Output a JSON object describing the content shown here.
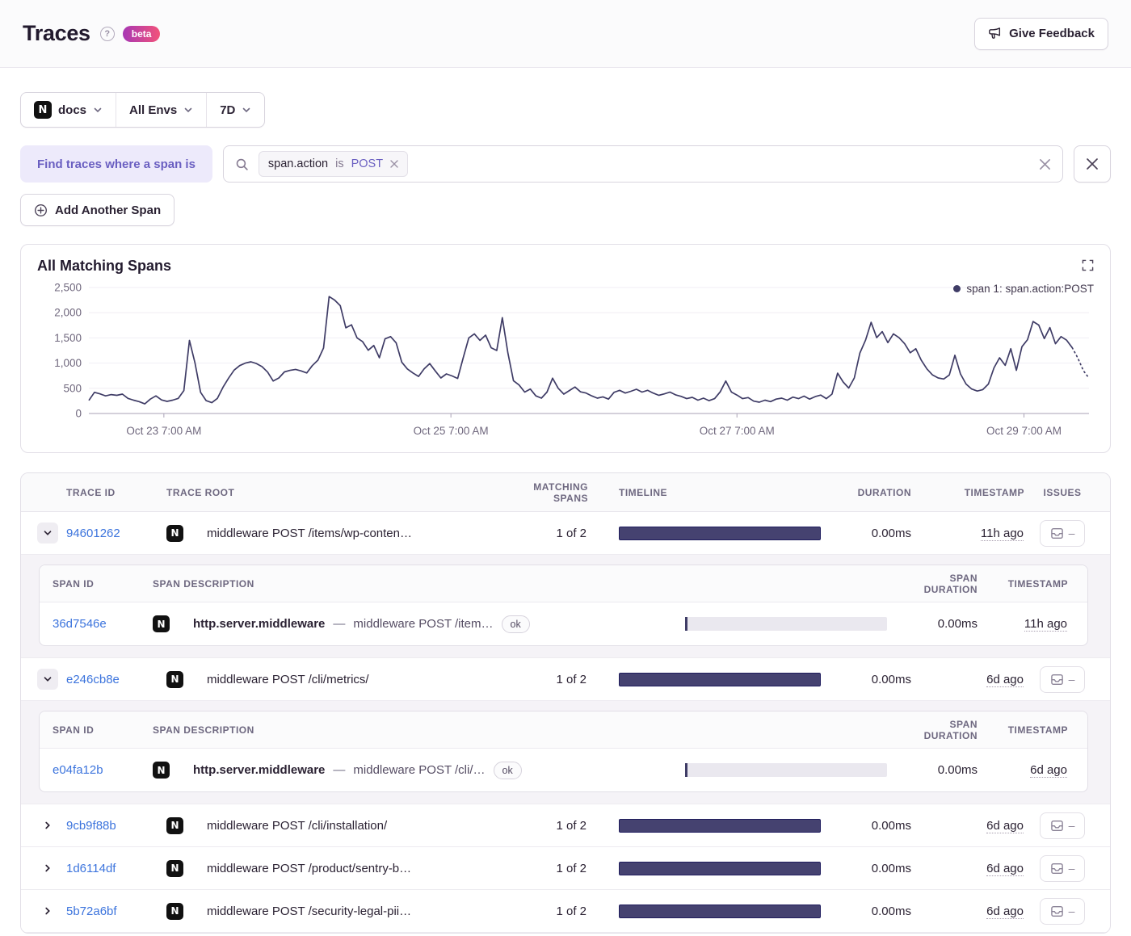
{
  "header": {
    "title": "Traces",
    "beta_label": "beta",
    "feedback_label": "Give Feedback"
  },
  "filters": {
    "project": "docs",
    "project_icon_letter": "N",
    "environment": "All Envs",
    "period": "7D"
  },
  "span_filter": {
    "label": "Find traces where a span is",
    "token": {
      "key": "span.action",
      "op": "is",
      "value": "POST"
    },
    "add_button_label": "Add Another Span",
    "search_value": "",
    "search_placeholder": ""
  },
  "chart": {
    "title": "All Matching Spans",
    "legend_label": "span 1: span.action:POST"
  },
  "chart_data": {
    "type": "line",
    "title": "All Matching Spans",
    "ylim": [
      0,
      2500
    ],
    "y_ticks": [
      0,
      500,
      1000,
      1500,
      2000,
      2500
    ],
    "y_tick_labels": [
      "0",
      "500",
      "1,000",
      "1,500",
      "2,000",
      "2,500"
    ],
    "x_tick_labels": [
      "Oct 23 7:00 AM",
      "Oct 25 7:00 AM",
      "Oct 27 7:00 AM",
      "Oct 29 7:00 AM"
    ],
    "x_tick_fractions": [
      0.075,
      0.362,
      0.648,
      0.935
    ],
    "grid": true,
    "legend_position": "top-right",
    "dashed_tail_count": 4,
    "series": [
      {
        "name": "span 1: span.action:POST",
        "color": "#3f3c66",
        "values": [
          260,
          420,
          390,
          350,
          375,
          360,
          385,
          300,
          265,
          235,
          190,
          285,
          350,
          270,
          240,
          265,
          300,
          455,
          1450,
          1000,
          420,
          255,
          215,
          300,
          520,
          700,
          860,
          950,
          1000,
          1025,
          990,
          930,
          820,
          645,
          705,
          825,
          855,
          875,
          845,
          805,
          950,
          1060,
          1300,
          2320,
          2250,
          2140,
          1700,
          1760,
          1500,
          1425,
          1255,
          1350,
          1105,
          1480,
          1525,
          1400,
          1020,
          885,
          805,
          735,
          885,
          990,
          845,
          705,
          785,
          745,
          695,
          1105,
          1500,
          1580,
          1450,
          1555,
          1305,
          1250,
          1900,
          1200,
          650,
          565,
          425,
          485,
          350,
          305,
          425,
          700,
          500,
          385,
          455,
          525,
          430,
          405,
          350,
          305,
          330,
          285,
          420,
          460,
          405,
          440,
          480,
          425,
          460,
          405,
          360,
          390,
          425,
          370,
          340,
          295,
          320,
          265,
          305,
          255,
          295,
          430,
          645,
          425,
          365,
          295,
          315,
          245,
          225,
          265,
          235,
          285,
          305,
          265,
          325,
          295,
          345,
          285,
          335,
          365,
          295,
          385,
          800,
          625,
          505,
          705,
          1200,
          1455,
          1810,
          1505,
          1625,
          1405,
          1580,
          1505,
          1385,
          1205,
          1285,
          1055,
          885,
          765,
          705,
          685,
          765,
          1155,
          785,
          585,
          485,
          445,
          475,
          585,
          905,
          1105,
          955,
          1285,
          855,
          1325,
          1465,
          1825,
          1755,
          1485,
          1705,
          1385,
          1525,
          1455,
          1305,
          1100,
          850,
          700
        ]
      }
    ]
  },
  "table": {
    "columns": [
      "TRACE ID",
      "TRACE ROOT",
      "MATCHING SPANS",
      "TIMELINE",
      "DURATION",
      "TIMESTAMP",
      "ISSUES"
    ],
    "span_columns": [
      "SPAN ID",
      "SPAN DESCRIPTION",
      "SPAN DURATION",
      "TIMESTAMP"
    ],
    "issues_empty": "–",
    "span_separator": "—",
    "rows": [
      {
        "trace_id": "94601262",
        "root": "middleware POST /items/wp-conten…",
        "matching": "1 of 2",
        "duration": "0.00ms",
        "age": "11h ago",
        "expanded": true,
        "spans": [
          {
            "span_id": "36d7546e",
            "op": "http.server.middleware",
            "desc": "middleware POST /item…",
            "status": "ok",
            "duration": "0.00ms",
            "age": "11h ago"
          }
        ]
      },
      {
        "trace_id": "e246cb8e",
        "root": "middleware POST /cli/metrics/",
        "matching": "1 of 2",
        "duration": "0.00ms",
        "age": "6d ago",
        "expanded": true,
        "spans": [
          {
            "span_id": "e04fa12b",
            "op": "http.server.middleware",
            "desc": "middleware POST /cli/…",
            "status": "ok",
            "duration": "0.00ms",
            "age": "6d ago"
          }
        ]
      },
      {
        "trace_id": "9cb9f88b",
        "root": "middleware POST /cli/installation/",
        "matching": "1 of 2",
        "duration": "0.00ms",
        "age": "6d ago",
        "expanded": false
      },
      {
        "trace_id": "1d6114df",
        "root": "middleware POST /product/sentry-b…",
        "matching": "1 of 2",
        "duration": "0.00ms",
        "age": "6d ago",
        "expanded": false
      },
      {
        "trace_id": "5b72a6bf",
        "root": "middleware POST /security-legal-pii…",
        "matching": "1 of 2",
        "duration": "0.00ms",
        "age": "6d ago",
        "expanded": false
      }
    ]
  },
  "colors": {
    "accent_purple": "#6a5fc1",
    "link_blue": "#3c74dd",
    "chart_line": "#3f3c66",
    "timeline_bar_fill": "#454270",
    "timeline_bar_border": "#201d5e",
    "beta_gradient_start": "#a737b4",
    "beta_gradient_end": "#f2527a"
  }
}
